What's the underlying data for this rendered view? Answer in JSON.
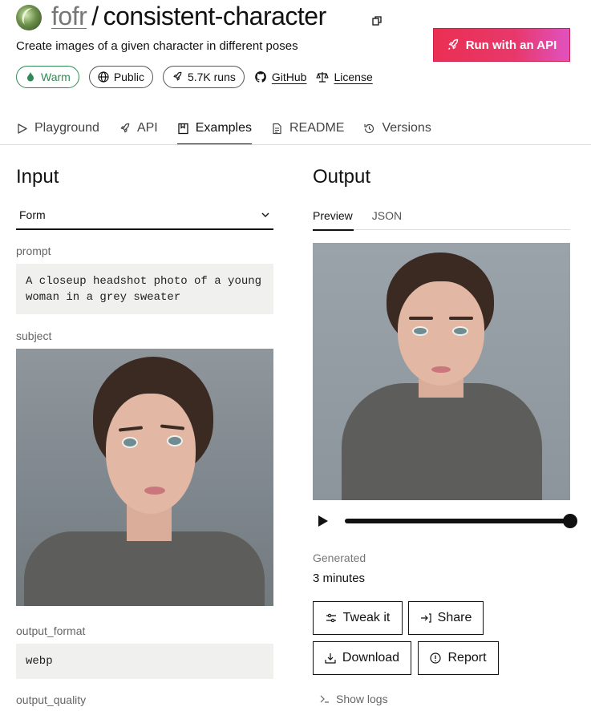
{
  "header": {
    "owner": "fofr",
    "slash": "/",
    "model": "consistent-character",
    "description": "Create images of a given character in different poses",
    "api_button": "Run with an API"
  },
  "badges": {
    "warm": "Warm",
    "public": "Public",
    "runs": "5.7K runs",
    "github": "GitHub",
    "license": "License"
  },
  "tabs": [
    {
      "label": "Playground"
    },
    {
      "label": "API"
    },
    {
      "label": "Examples"
    },
    {
      "label": "README"
    },
    {
      "label": "Versions"
    }
  ],
  "input": {
    "title": "Input",
    "mode": "Form",
    "prompt_label": "prompt",
    "prompt_value": "A closeup headshot photo of a young woman in a grey sweater",
    "subject_label": "subject",
    "output_format_label": "output_format",
    "output_format_value": "webp",
    "output_quality_label": "output_quality"
  },
  "output": {
    "title": "Output",
    "tab_preview": "Preview",
    "tab_json": "JSON",
    "generated_label": "Generated",
    "generated_value": "3 minutes",
    "tweak": "Tweak it",
    "share": "Share",
    "download": "Download",
    "report": "Report",
    "show_logs": "Show logs"
  },
  "colors": {
    "accent_start": "#ea2f52",
    "accent_end": "#e052c0",
    "warm_green": "#2f8a55"
  }
}
